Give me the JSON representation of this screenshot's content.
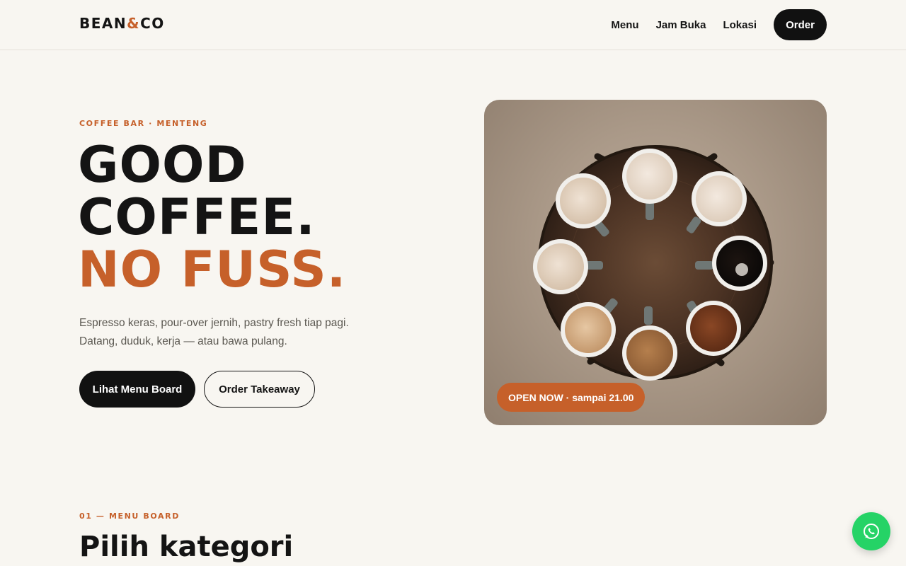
{
  "brand": {
    "logo_part1": "BEAN",
    "logo_amp": "&",
    "logo_part2": "CO"
  },
  "nav": {
    "links": [
      "Menu",
      "Jam Buka",
      "Lokasi"
    ],
    "order_label": "Order"
  },
  "hero": {
    "eyebrow": "COFFEE BAR · MENTENG",
    "headline_line1": "GOOD",
    "headline_line2": "COFFEE.",
    "headline_line3": "NO FUSS.",
    "lead_line1": "Espresso keras, pour-over jernih, pastry fresh tiap pagi.",
    "lead_line2": "Datang, duduk, kerja — atau bawa pulang.",
    "primary_cta": "Lihat Menu Board",
    "secondary_cta": "Order Takeaway",
    "status_badge": "OPEN NOW · sampai 21.00",
    "image_icon": "coffee-cups-photo"
  },
  "menu_section": {
    "eyebrow": "01 — MENU BOARD",
    "title": "Pilih kategori"
  },
  "fab": {
    "icon": "whatsapp-icon"
  },
  "colors": {
    "background": "#f8f6f1",
    "ink": "#141414",
    "accent": "#c6602a",
    "whatsapp": "#25d366"
  }
}
